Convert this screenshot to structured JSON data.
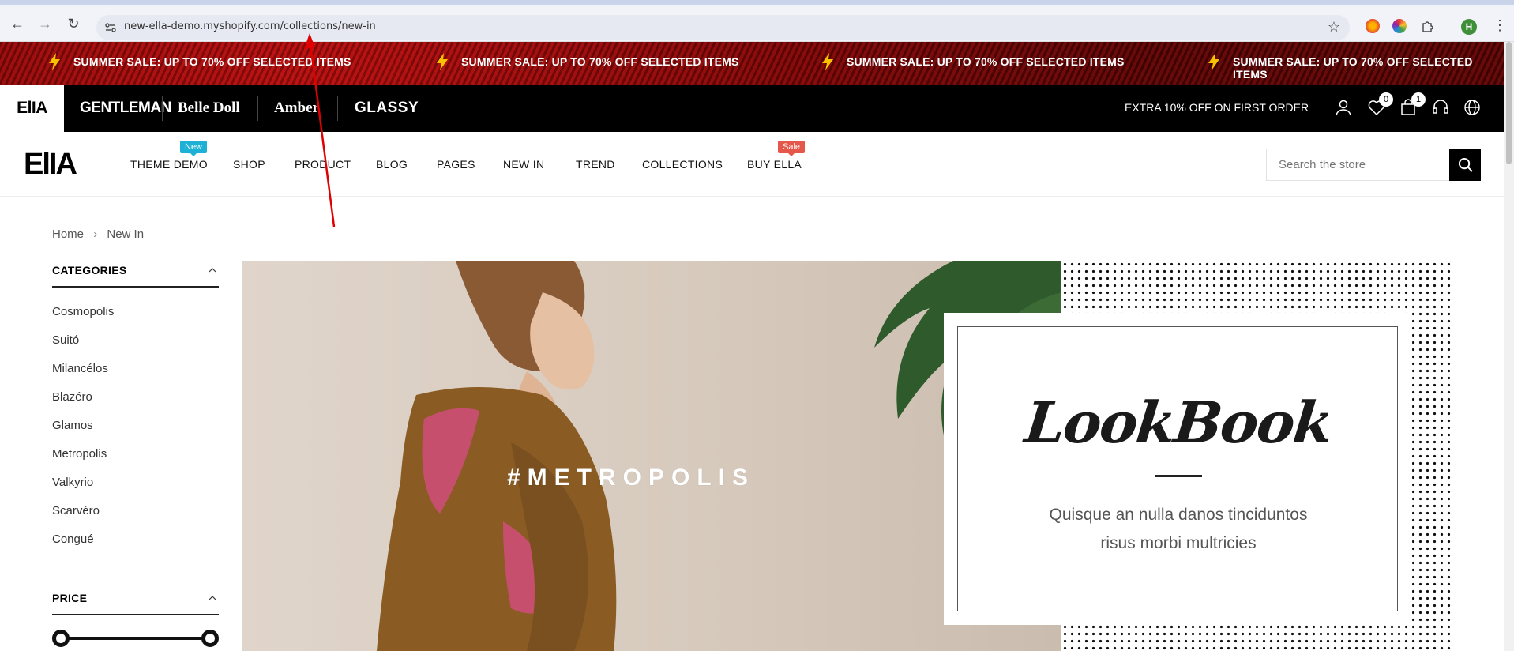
{
  "browser": {
    "url": "new-ella-demo.myshopify.com/collections/new-in",
    "profile_initial": "H"
  },
  "announcement": {
    "messages": [
      "SUMMER SALE: UP TO 70% OFF SELECTED ITEMS",
      "SUMMER SALE: UP TO 70% OFF SELECTED ITEMS",
      "SUMMER SALE: UP TO 70% OFF SELECTED ITEMS",
      "SUMMER SALE: UP TO 70% OFF SELECTED ITEMS"
    ]
  },
  "storebar": {
    "active_store": "ElIA",
    "stores": [
      "GENTLEMAN",
      "Belle Doll",
      "Amber",
      "GLASSY"
    ],
    "promo": "EXTRA 10% OFF ON FIRST ORDER",
    "wishlist_count": "0",
    "cart_count": "1"
  },
  "header": {
    "logo": "ElIA",
    "menu": [
      {
        "label": "THEME DEMO",
        "badge": "New"
      },
      {
        "label": "SHOP"
      },
      {
        "label": "PRODUCT"
      },
      {
        "label": "BLOG"
      },
      {
        "label": "PAGES"
      },
      {
        "label": "NEW IN"
      },
      {
        "label": "TREND"
      },
      {
        "label": "COLLECTIONS"
      },
      {
        "label": "BUY ELLA",
        "badge": "Sale"
      }
    ],
    "search_placeholder": "Search the store"
  },
  "breadcrumb": {
    "home": "Home",
    "current": "New In"
  },
  "sidebar": {
    "categories_title": "CATEGORIES",
    "categories": [
      "Cosmopolis",
      "Suitó",
      "Milancélos",
      "Blazéro",
      "Glamos",
      "Metropolis",
      "Valkyrio",
      "Scarvéro",
      "Congué"
    ],
    "price_title": "PRICE"
  },
  "banner": {
    "hashtag": "#METROPOLIS",
    "lookbook_title": "LookBook",
    "lookbook_line1": "Quisque an nulla danos tinciduntos",
    "lookbook_line2": "risus morbi multricies"
  },
  "colors": {
    "new_badge": "#1eb1d6",
    "sale_badge": "#e5574a",
    "announcement_red": "#8c0707"
  }
}
